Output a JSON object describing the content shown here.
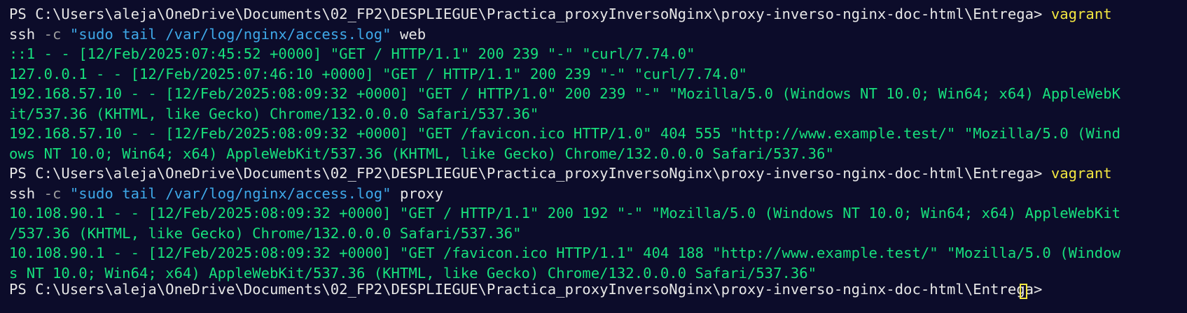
{
  "session1": {
    "prompt": "PS C:\\Users\\aleja\\OneDrive\\Documents\\02_FP2\\DESPLIEGUE\\Practica_proxyInversoNginx\\proxy-inverso-nginx-doc-html\\Entrega> ",
    "command": "vagrant",
    "subcommand": "ssh",
    "flag": "-c",
    "quoted_arg": "\"sudo tail /var/log/nginx/access.log\"",
    "target": "web",
    "output": [
      "::1 - - [12/Feb/2025:07:45:52 +0000] \"GET / HTTP/1.1\" 200 239 \"-\" \"curl/7.74.0\"",
      "127.0.0.1 - - [12/Feb/2025:07:46:10 +0000] \"GET / HTTP/1.1\" 200 239 \"-\" \"curl/7.74.0\"",
      "192.168.57.10 - - [12/Feb/2025:08:09:32 +0000] \"GET / HTTP/1.0\" 200 239 \"-\" \"Mozilla/5.0 (Windows NT 10.0; Win64; x64) AppleWebK",
      "it/537.36 (KHTML, like Gecko) Chrome/132.0.0.0 Safari/537.36\"",
      "192.168.57.10 - - [12/Feb/2025:08:09:32 +0000] \"GET /favicon.ico HTTP/1.0\" 404 555 \"http://www.example.test/\" \"Mozilla/5.0 (Wind",
      "ows NT 10.0; Win64; x64) AppleWebKit/537.36 (KHTML, like Gecko) Chrome/132.0.0.0 Safari/537.36\""
    ]
  },
  "session2": {
    "prompt": "PS C:\\Users\\aleja\\OneDrive\\Documents\\02_FP2\\DESPLIEGUE\\Practica_proxyInversoNginx\\proxy-inverso-nginx-doc-html\\Entrega> ",
    "command": "vagrant",
    "subcommand": "ssh",
    "flag": "-c",
    "quoted_arg": "\"sudo tail /var/log/nginx/access.log\"",
    "target": "proxy",
    "output": [
      "10.108.90.1 - - [12/Feb/2025:08:09:32 +0000] \"GET / HTTP/1.1\" 200 192 \"-\" \"Mozilla/5.0 (Windows NT 10.0; Win64; x64) AppleWebKit",
      "/537.36 (KHTML, like Gecko) Chrome/132.0.0.0 Safari/537.36\"",
      "10.108.90.1 - - [12/Feb/2025:08:09:32 +0000] \"GET /favicon.ico HTTP/1.1\" 404 188 \"http://www.example.test/\" \"Mozilla/5.0 (Window",
      "s NT 10.0; Win64; x64) AppleWebKit/537.36 (KHTML, like Gecko) Chrome/132.0.0.0 Safari/537.36\""
    ]
  },
  "next_prompt": "PS C:\\Users\\aleja\\OneDrive\\Documents\\02_FP2\\DESPLIEGUE\\Practica_proxyInversoNginx\\proxy-inverso-nginx-doc-html\\Entrega>",
  "colors": {
    "background": "#0c0c2a",
    "log_output": "#17e07d",
    "command": "#f2e640",
    "flag": "#9e9e9e",
    "string": "#3ea8e8",
    "text": "#e6e6e6"
  },
  "icons": {
    "cursor": "block-cursor-icon"
  }
}
